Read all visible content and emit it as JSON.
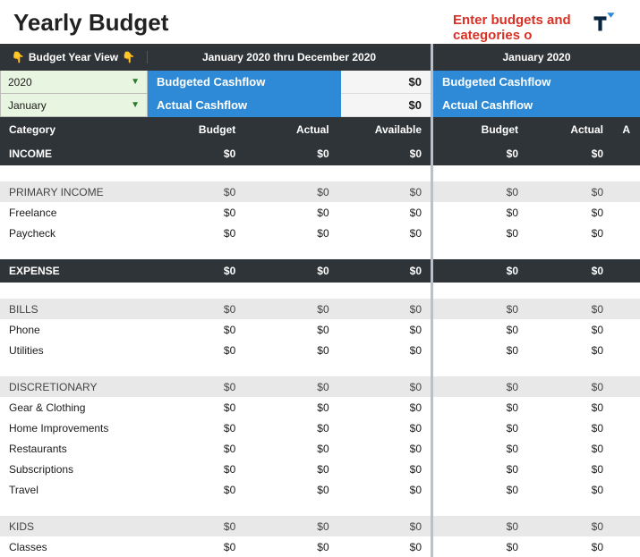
{
  "title": "Yearly Budget",
  "warning": "Enter budgets and categories o",
  "controls": {
    "budget_year_view_label": "Budget Year View",
    "year_selected": "2020",
    "month_selected": "January"
  },
  "left_period": "January 2020 thru December 2020",
  "right_period": "January 2020",
  "cashflow": {
    "budgeted_label": "Budgeted Cashflow",
    "budgeted_value": "$0",
    "actual_label": "Actual Cashflow",
    "actual_value": "$0"
  },
  "headers": {
    "category": "Category",
    "budget": "Budget",
    "actual": "Actual",
    "available": "Available",
    "available_cut": "A"
  },
  "rows": [
    {
      "type": "section",
      "label": "INCOME",
      "b": "$0",
      "a": "$0",
      "v": "$0"
    },
    {
      "type": "blank"
    },
    {
      "type": "group",
      "label": "PRIMARY INCOME",
      "b": "$0",
      "a": "$0",
      "v": "$0"
    },
    {
      "type": "item",
      "label": "Freelance",
      "b": "$0",
      "a": "$0",
      "v": "$0"
    },
    {
      "type": "item",
      "label": "Paycheck",
      "b": "$0",
      "a": "$0",
      "v": "$0"
    },
    {
      "type": "blank"
    },
    {
      "type": "section",
      "label": "EXPENSE",
      "b": "$0",
      "a": "$0",
      "v": "$0"
    },
    {
      "type": "blank"
    },
    {
      "type": "group",
      "label": "BILLS",
      "b": "$0",
      "a": "$0",
      "v": "$0"
    },
    {
      "type": "item",
      "label": "Phone",
      "b": "$0",
      "a": "$0",
      "v": "$0"
    },
    {
      "type": "item",
      "label": "Utilities",
      "b": "$0",
      "a": "$0",
      "v": "$0"
    },
    {
      "type": "blank"
    },
    {
      "type": "group",
      "label": "DISCRETIONARY",
      "b": "$0",
      "a": "$0",
      "v": "$0"
    },
    {
      "type": "item",
      "label": "Gear & Clothing",
      "b": "$0",
      "a": "$0",
      "v": "$0"
    },
    {
      "type": "item",
      "label": "Home Improvements",
      "b": "$0",
      "a": "$0",
      "v": "$0"
    },
    {
      "type": "item",
      "label": "Restaurants",
      "b": "$0",
      "a": "$0",
      "v": "$0"
    },
    {
      "type": "item",
      "label": "Subscriptions",
      "b": "$0",
      "a": "$0",
      "v": "$0"
    },
    {
      "type": "item",
      "label": "Travel",
      "b": "$0",
      "a": "$0",
      "v": "$0"
    },
    {
      "type": "blank"
    },
    {
      "type": "group",
      "label": "KIDS",
      "b": "$0",
      "a": "$0",
      "v": "$0"
    },
    {
      "type": "item",
      "label": "Classes",
      "b": "$0",
      "a": "$0",
      "v": "$0"
    }
  ]
}
